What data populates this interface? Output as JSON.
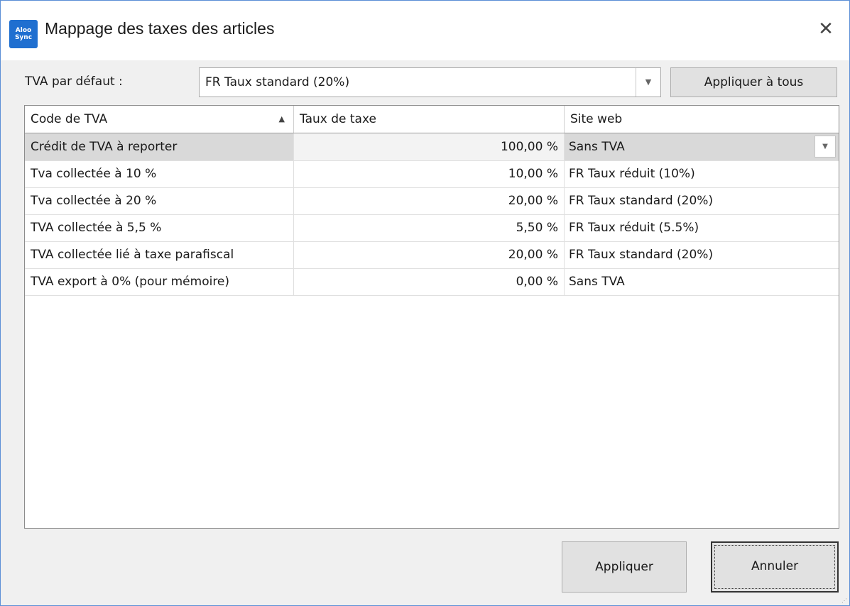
{
  "window": {
    "title": "Mappage des taxes des articles",
    "app_icon_text": "Aloo Sync",
    "close_glyph": "✕"
  },
  "default_tax": {
    "label": "TVA par défaut :",
    "selected": "FR Taux standard (20%)",
    "apply_all_label": "Appliquer à tous"
  },
  "grid": {
    "columns": [
      "Code de TVA",
      "Taux de taxe",
      "Site web"
    ],
    "sort_column": 0,
    "sort_direction": "asc",
    "rows": [
      {
        "code": "Crédit de TVA à reporter",
        "rate": "100,00 %",
        "site": "Sans TVA",
        "selected": true
      },
      {
        "code": "Tva collectée à 10 %",
        "rate": "10,00 %",
        "site": "FR Taux réduit (10%)"
      },
      {
        "code": "Tva collectée à 20 %",
        "rate": "20,00 %",
        "site": "FR Taux standard (20%)"
      },
      {
        "code": "TVA collectée à 5,5 %",
        "rate": "5,50 %",
        "site": "FR Taux réduit (5.5%)"
      },
      {
        "code": "TVA collectée lié à taxe parafiscal",
        "rate": "20,00 %",
        "site": "FR Taux standard (20%)"
      },
      {
        "code": "TVA export à 0% (pour mémoire)",
        "rate": "0,00 %",
        "site": "Sans TVA"
      }
    ]
  },
  "footer": {
    "apply_label": "Appliquer",
    "cancel_label": "Annuler"
  },
  "icons": {
    "app": "app-logo-icon",
    "close": "close-icon",
    "dropdown": "chevron-down-icon",
    "sort": "sort-ascending-icon"
  }
}
